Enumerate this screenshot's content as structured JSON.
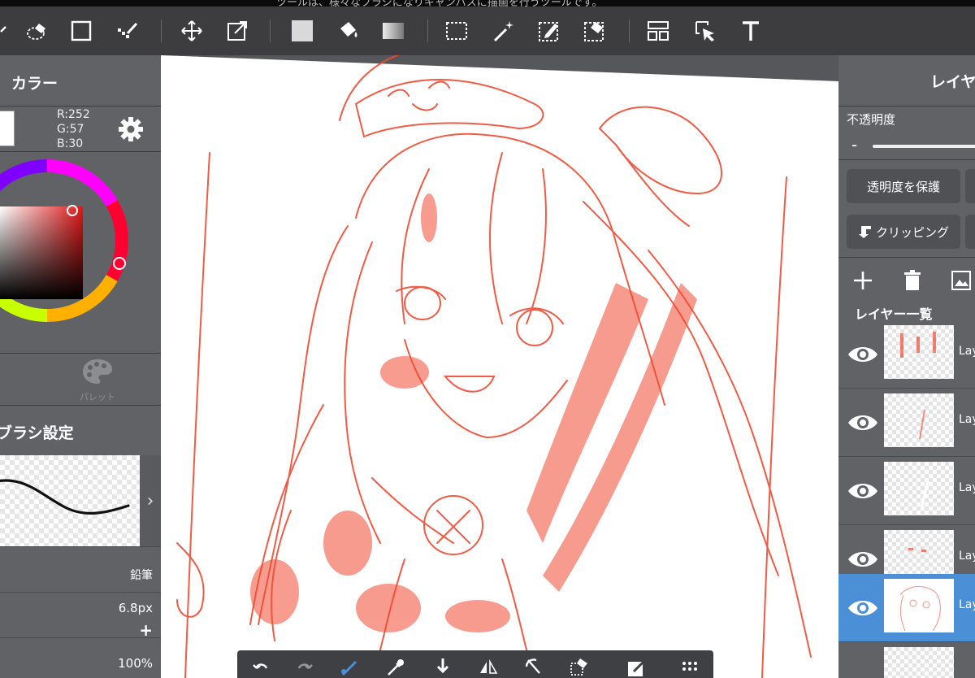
{
  "banner": {
    "text": "ツールは、様々なブラシになりキャンバスに描画を行うツールです。"
  },
  "toolbar": {
    "tools": [
      "lasso-icon",
      "eraser-icon",
      "rectangle-icon",
      "dot-brush-icon",
      "move-icon",
      "transform-icon",
      "fill-color-icon",
      "bucket-icon",
      "gradient-icon",
      "select-rect-icon",
      "magic-wand-icon",
      "select-pen-icon",
      "select-eraser-icon",
      "layout-icon",
      "select-pointer-icon",
      "text-icon"
    ]
  },
  "color_panel": {
    "title": "カラー",
    "rgb": {
      "r": "R:252",
      "g": "G:57",
      "b": "B:30"
    },
    "current_color": "#fc391e",
    "palette_label": "パレット"
  },
  "brush_panel": {
    "title": "ブラシ設定",
    "brush_name": "鉛筆",
    "size": "6.8px",
    "plus": "+",
    "opacity": "100%"
  },
  "layer_panel": {
    "title": "レイヤー",
    "opacity_label": "不透明度",
    "opacity_minus": "-",
    "protect_alpha": "透明度を保護",
    "clipping": "クリッピング",
    "list_title": "レイヤー一覧",
    "layers": [
      {
        "name": "Lay",
        "visible": true,
        "selected": false
      },
      {
        "name": "Lay",
        "visible": true,
        "selected": false
      },
      {
        "name": "Lay",
        "visible": true,
        "selected": false
      },
      {
        "name": "Lay",
        "visible": true,
        "selected": false
      },
      {
        "name": "Lay",
        "visible": true,
        "selected": true
      }
    ]
  },
  "bottom_bar": {
    "tools": [
      "undo-icon",
      "redo-icon",
      "pen-icon",
      "eyedropper-icon",
      "download-icon",
      "flip-icon",
      "rotate-icon",
      "eraser-icon",
      "export-icon",
      "grid-menu-icon"
    ]
  },
  "colors": {
    "accent": "#4b8fd6",
    "sketch": "#fc391e",
    "panel": "#616266",
    "toolbar": "#3d3d40"
  }
}
